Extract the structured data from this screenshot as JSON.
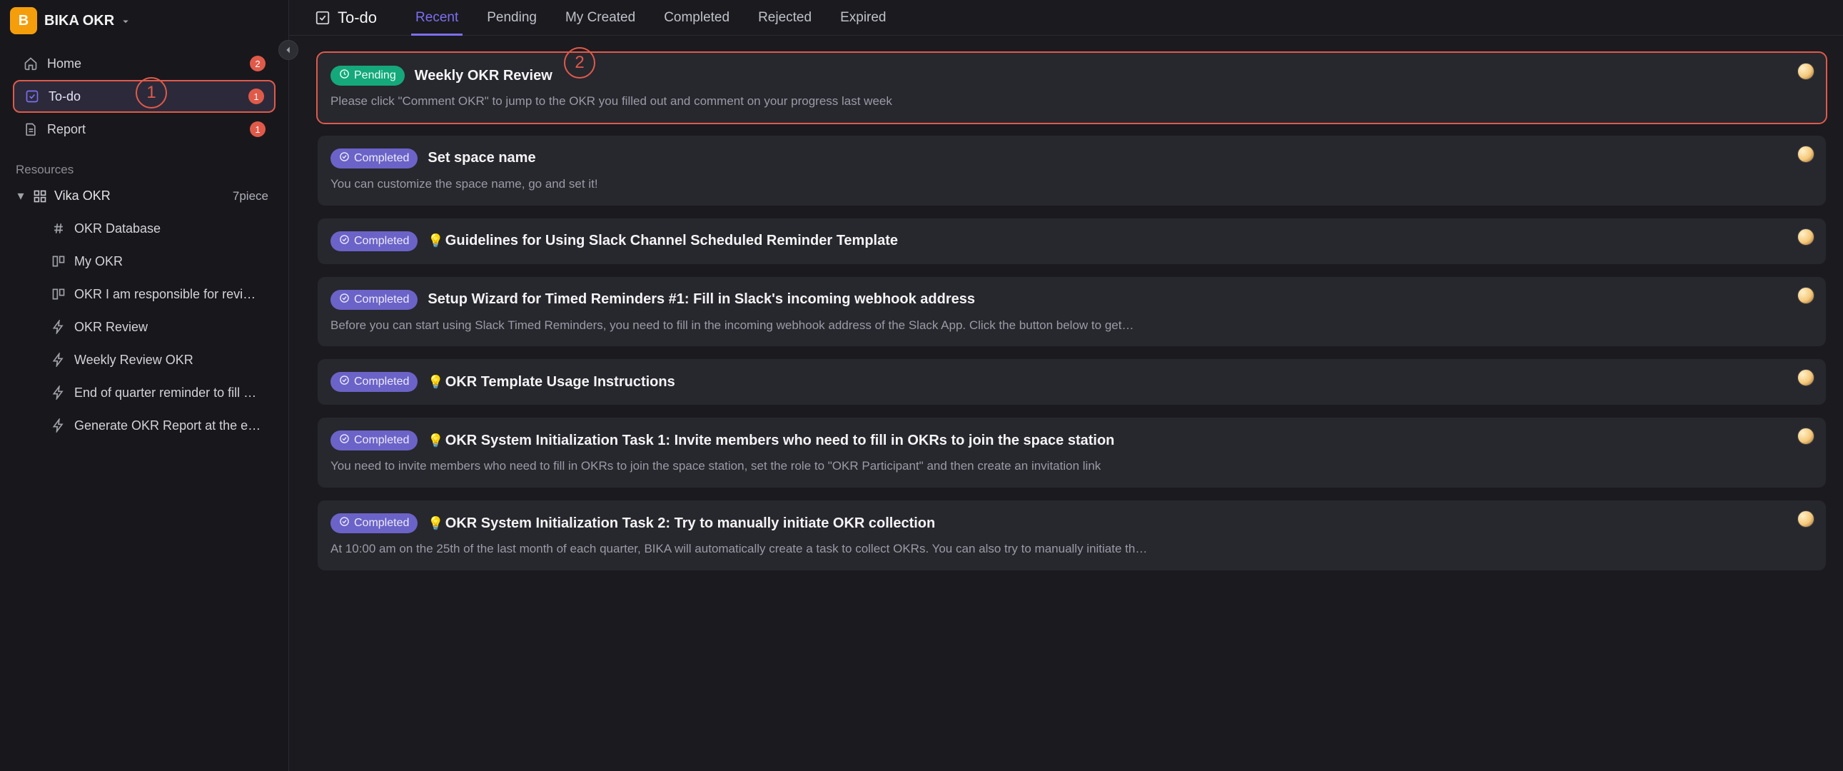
{
  "workspace": {
    "logo_letter": "B",
    "name": "BIKA OKR"
  },
  "nav": {
    "items": [
      {
        "label": "Home",
        "icon": "home",
        "badge": "2",
        "active": false,
        "highlight": false
      },
      {
        "label": "To-do",
        "icon": "check",
        "badge": "1",
        "active": true,
        "highlight": true
      },
      {
        "label": "Report",
        "icon": "doc",
        "badge": "1",
        "active": false,
        "highlight": false
      }
    ]
  },
  "resources": {
    "section_label": "Resources",
    "space": {
      "name": "Vika OKR",
      "count_label": "7piece"
    },
    "tree": [
      {
        "icon": "hash",
        "label": "OKR Database"
      },
      {
        "icon": "board",
        "label": "My OKR"
      },
      {
        "icon": "board",
        "label": "OKR I am responsible for revi…"
      },
      {
        "icon": "bolt",
        "label": "OKR Review"
      },
      {
        "icon": "bolt",
        "label": "Weekly Review OKR"
      },
      {
        "icon": "bolt",
        "label": "End of quarter reminder to fill …"
      },
      {
        "icon": "bolt",
        "label": "Generate OKR Report at the e…"
      }
    ]
  },
  "topbar": {
    "title": "To-do",
    "tabs": [
      {
        "label": "Recent",
        "active": true
      },
      {
        "label": "Pending",
        "active": false
      },
      {
        "label": "My Created",
        "active": false
      },
      {
        "label": "Completed",
        "active": false
      },
      {
        "label": "Rejected",
        "active": false
      },
      {
        "label": "Expired",
        "active": false
      }
    ]
  },
  "status_labels": {
    "pending": "Pending",
    "completed": "Completed"
  },
  "cards": [
    {
      "status": "pending",
      "title": "Weekly OKR Review",
      "desc": "Please click \"Comment OKR\" to jump to the OKR you filled out and comment on your progress last week",
      "bulb": false,
      "highlight": true
    },
    {
      "status": "completed",
      "title": "Set space name",
      "desc": "You can customize the space name, go and set it!",
      "bulb": false
    },
    {
      "status": "completed",
      "title": "Guidelines for Using Slack Channel Scheduled Reminder Template",
      "desc": "",
      "bulb": true
    },
    {
      "status": "completed",
      "title": "Setup Wizard for Timed Reminders #1: Fill in Slack's incoming webhook address",
      "desc": "Before you can start using Slack Timed Reminders, you need to fill in the incoming webhook address of the Slack App. Click the button below to get…",
      "bulb": false
    },
    {
      "status": "completed",
      "title": "OKR Template Usage Instructions",
      "desc": "",
      "bulb": true
    },
    {
      "status": "completed",
      "title": "OKR System Initialization Task 1: Invite members who need to fill in OKRs to join the space station",
      "desc": "You need to invite members who need to fill in OKRs to join the space station, set the role to \"OKR Participant\" and then create an invitation link",
      "bulb": true
    },
    {
      "status": "completed",
      "title": "OKR System Initialization Task 2: Try to manually initiate OKR collection",
      "desc": "At 10:00 am on the 25th of the last month of each quarter, BIKA will automatically create a task to collect OKRs. You can also try to manually initiate th…",
      "bulb": true
    }
  ],
  "annotations": {
    "one": "1",
    "two": "2"
  }
}
